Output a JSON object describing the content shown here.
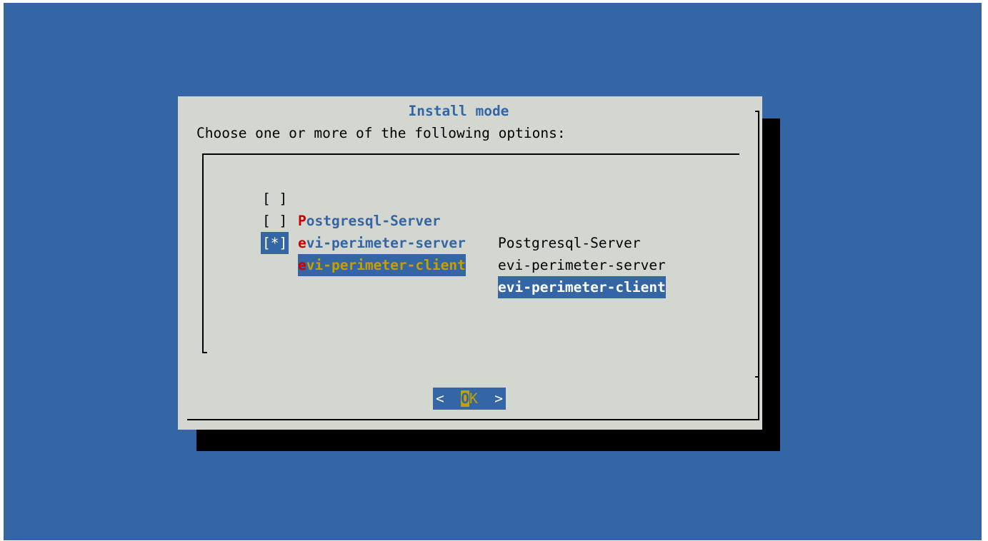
{
  "dialog": {
    "title": "Install mode",
    "prompt": "Choose one or more of the following options:"
  },
  "options": [
    {
      "check": "[ ]",
      "tag_hot": "P",
      "tag_rest": "ostgresql-Server",
      "item": "Postgresql-Server",
      "selected": false
    },
    {
      "check": "[ ]",
      "tag_hot": "e",
      "tag_rest": "vi-perimeter-server",
      "item": "evi-perimeter-server",
      "selected": false
    },
    {
      "check": "[*]",
      "tag_hot": "e",
      "tag_rest": "vi-perimeter-client",
      "item": "evi-perimeter-client",
      "selected": true
    }
  ],
  "buttons": {
    "ok_left": "<  ",
    "ok_hot": "O",
    "ok_rest": "K",
    "ok_right": "  >"
  },
  "colors": {
    "background": "#3465a4",
    "dialog": "#d3d7cf",
    "shadow": "#000000",
    "hotkey": "#cc0000",
    "selected_tag": "#c4a000"
  }
}
